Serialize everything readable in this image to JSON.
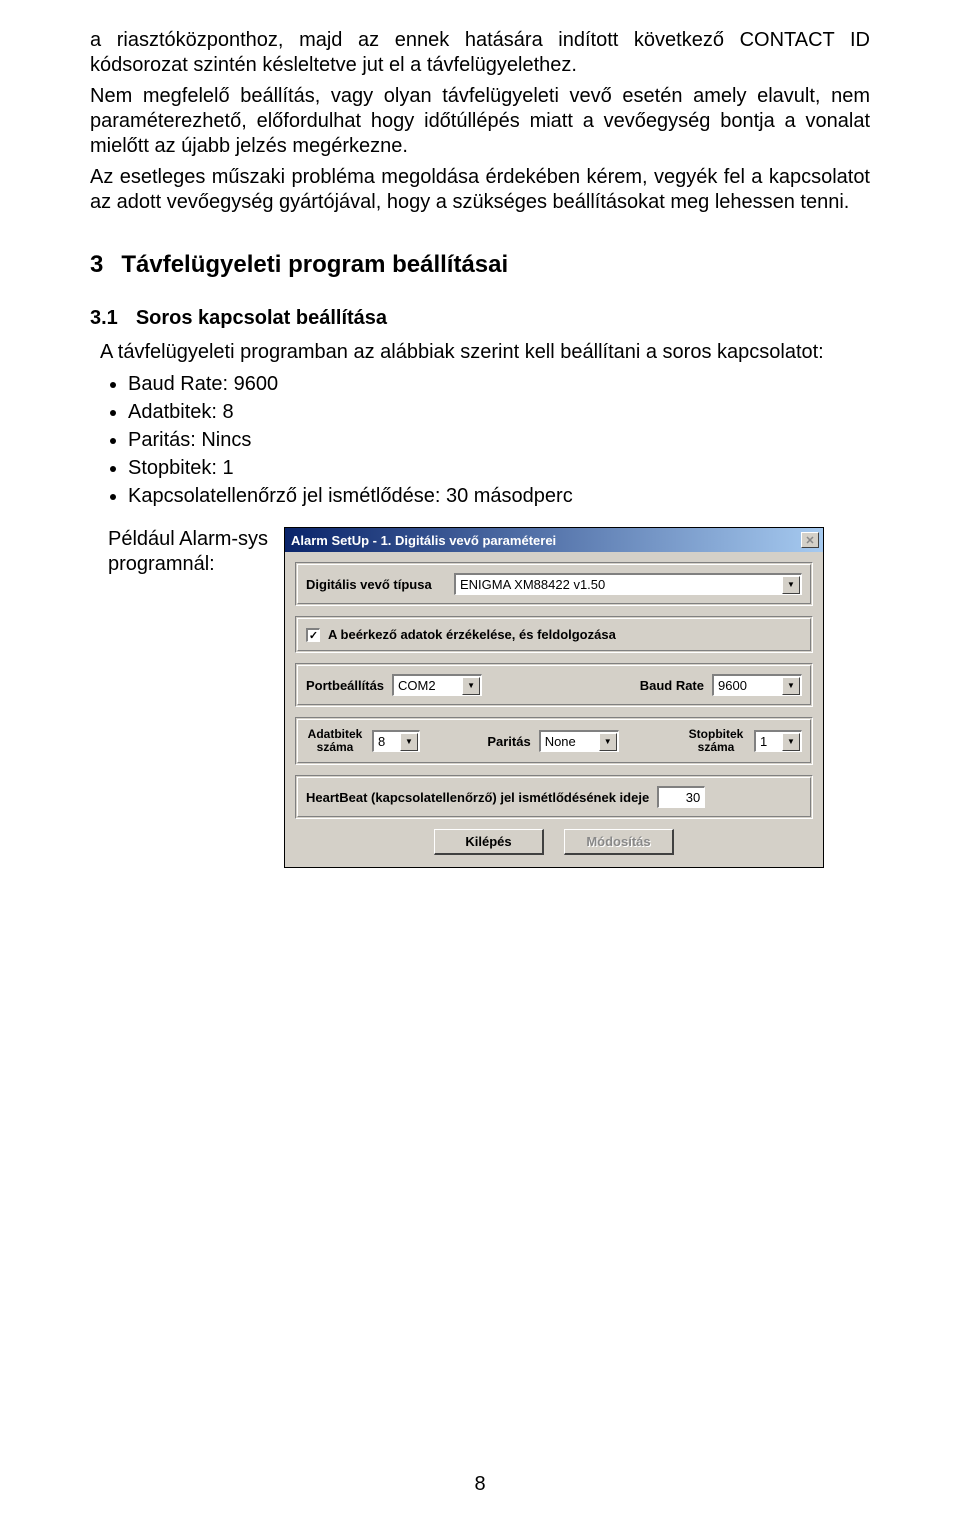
{
  "para1": "a riasztóközponthoz, majd az ennek hatására indított következő CONTACT ID kódsorozat szintén késleltetve jut el a távfelügyelethez.",
  "para2": "Nem megfelelő beállítás, vagy olyan távfelügyeleti vevő esetén amely elavult, nem paraméterezhető, előfordulhat hogy időtúllépés miatt a vevőegység bontja a vonalat mielőtt az újabb jelzés megérkezne.",
  "para3": "Az esetleges műszaki probléma megoldása érdekében kérem, vegyék fel a kapcsolatot az adott vevőegység gyártójával, hogy a szükséges beállításokat meg lehessen tenni.",
  "h1_num": "3",
  "h1_title": "Távfelügyeleti program beállításai",
  "h2_num": "3.1",
  "h2_title": "Soros kapcsolat beállítása",
  "list_intro": "A távfelügyeleti programban az alábbiak szerint kell beállítani a soros kapcsolatot:",
  "bullets": {
    "b1": "Baud Rate: 9600",
    "b2": "Adatbitek: 8",
    "b3": "Paritás: Nincs",
    "b4": "Stopbitek: 1",
    "b5": "Kapcsolatellenőrző jel ismétlődése: 30 másodperc"
  },
  "example_label": "Például Alarm-sys programnál:",
  "dialog": {
    "title": "Alarm SetUp - 1. Digitális vevő paraméterei",
    "type_label": "Digitális vevő típusa",
    "type_value": "ENIGMA XM88422 v1.50",
    "checkbox_label": "A beérkező adatok érzékelése, és feldolgozása",
    "checkbox_checked": "✓",
    "port_label": "Portbeállítás",
    "port_value": "COM2",
    "baud_label": "Baud Rate",
    "baud_value": "9600",
    "databits_label": "Adatbitek száma",
    "databits_value": "8",
    "parity_label": "Paritás",
    "parity_value": "None",
    "stopbits_label": "Stopbitek száma",
    "stopbits_value": "1",
    "heartbeat_label": "HeartBeat (kapcsolatellenőrző) jel ismétlődésének ideje",
    "heartbeat_value": "30",
    "btn_exit": "Kilépés",
    "btn_modify": "Módosítás"
  },
  "page_number": "8"
}
